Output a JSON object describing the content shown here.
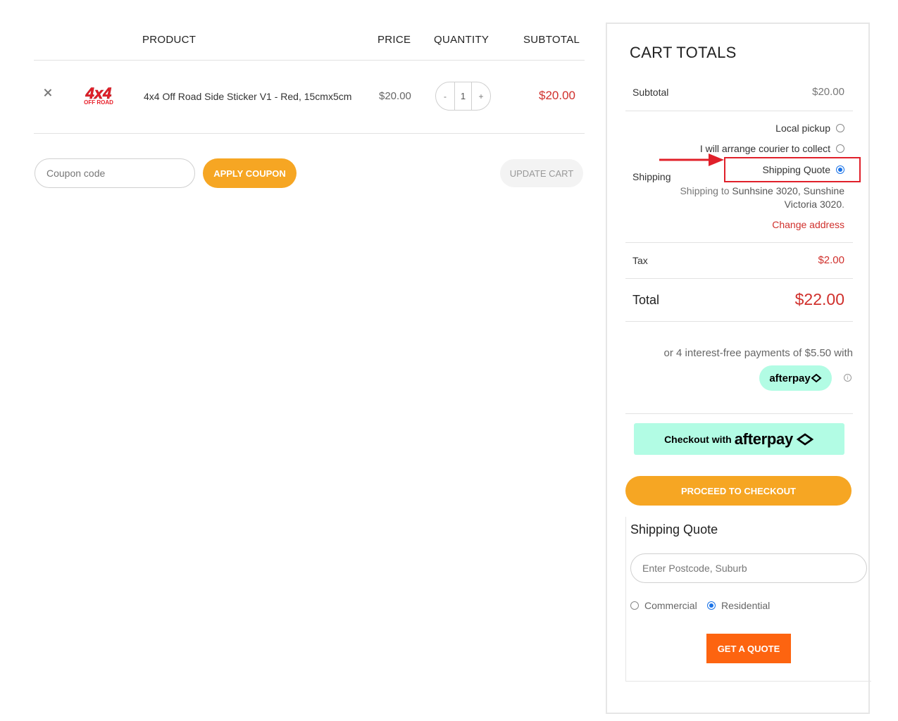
{
  "cart": {
    "headers": {
      "product": "PRODUCT",
      "price": "PRICE",
      "quantity": "QUANTITY",
      "subtotal": "SUBTOTAL"
    },
    "items": [
      {
        "name": "4x4 Off Road Side Sticker V1 - Red, 15cmx5cm",
        "price": "$20.00",
        "quantity": "1",
        "subtotal": "$20.00",
        "thumb_text": "4x4",
        "thumb_subtext": "OFF ROAD"
      }
    ],
    "qty_minus": "-",
    "qty_plus": "+",
    "coupon_placeholder": "Coupon code",
    "apply_coupon_label": "APPLY COUPON",
    "update_cart_label": "UPDATE CART"
  },
  "totals": {
    "title": "CART TOTALS",
    "subtotal_label": "Subtotal",
    "subtotal_value": "$20.00",
    "shipping_label": "Shipping",
    "shipping_options": [
      {
        "label": "Local pickup",
        "selected": false
      },
      {
        "label": "I will arrange courier to collect",
        "selected": false
      },
      {
        "label": "Shipping Quote",
        "selected": true
      }
    ],
    "shipping_to_prefix": "Shipping to",
    "shipping_to_location": "Sunhsine 3020, Sunshine Victoria 3020",
    "shipping_to_suffix": ".",
    "change_address": "Change address",
    "tax_label": "Tax",
    "tax_value": "$2.00",
    "total_label": "Total",
    "total_value": "$22.00",
    "afterpay_text": "or 4 interest-free payments of $5.50 with",
    "afterpay_brand": "afterpay",
    "info_symbol": "i",
    "checkout_afterpay_prefix": "Checkout with",
    "checkout_afterpay_brand": "afterpay",
    "proceed_label": "PROCEED TO CHECKOUT"
  },
  "quote": {
    "title": "Shipping Quote",
    "postcode_placeholder": "Enter Postcode, Suburb",
    "commercial_label": "Commercial",
    "residential_label": "Residential",
    "selected_type": "Residential",
    "get_quote_label": "GET A QUOTE"
  },
  "colors": {
    "accent_orange": "#f6a623",
    "quote_orange": "#fd6410",
    "price_red": "#d0302c",
    "afterpay_mint": "#b2fce4",
    "highlight_red": "#e0202a",
    "radio_blue": "#1a73e8"
  }
}
